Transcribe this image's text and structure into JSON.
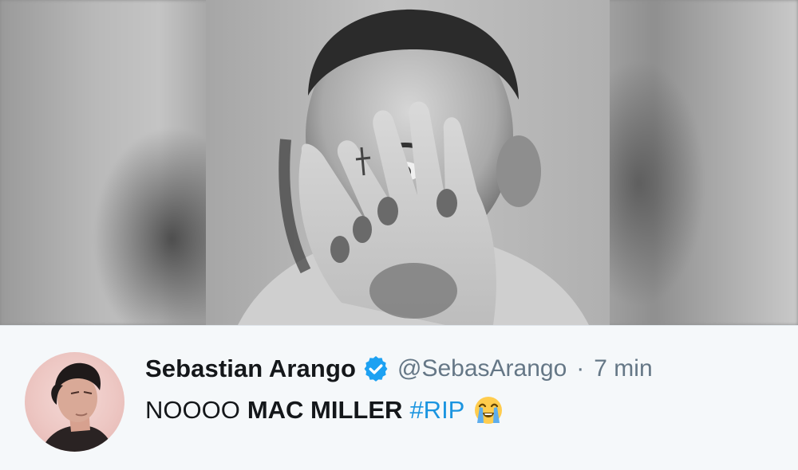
{
  "photo": {
    "description_icon": "portrait-photo"
  },
  "tweet": {
    "display_name": "Sebastian Arango",
    "verified": true,
    "handle": "@SebasArango",
    "separator": "·",
    "timestamp": "7 min",
    "text_parts": {
      "plain": "NOOOO",
      "bold": "MAC MILLER",
      "hashtag": "#RIP"
    },
    "emoji_icon": "loudly-crying-face-icon"
  },
  "colors": {
    "background": "#f5f8fa",
    "name": "#14171a",
    "meta": "#657786",
    "hashtag": "#1b95e0",
    "verified": "#1da1f2"
  }
}
